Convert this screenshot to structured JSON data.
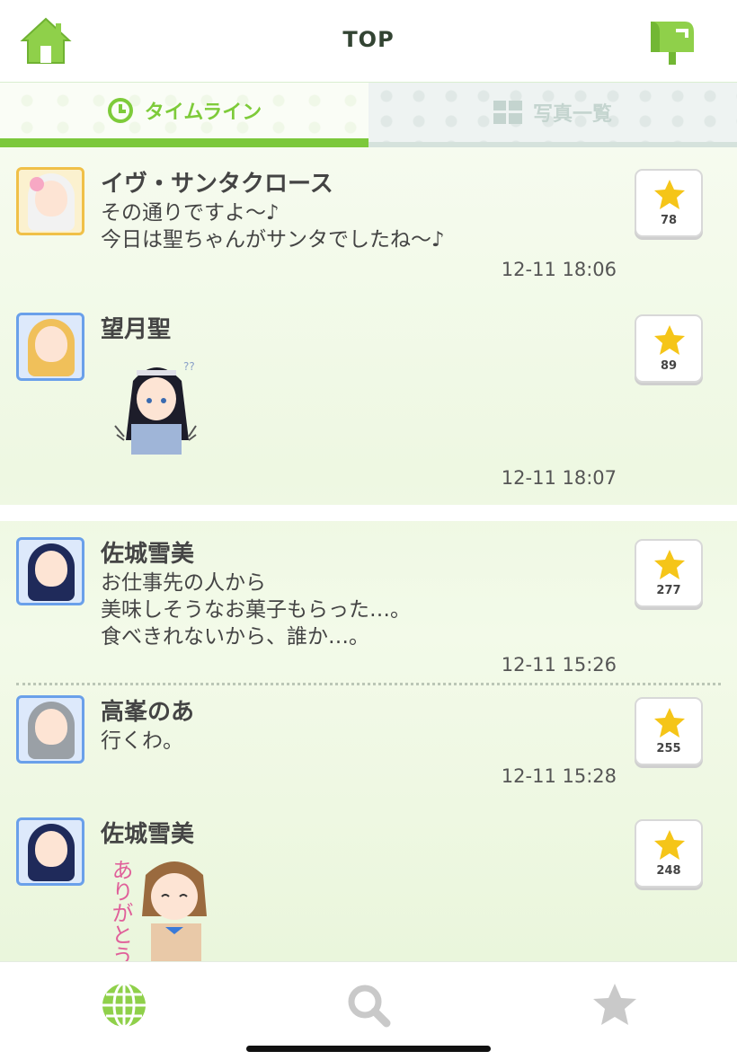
{
  "header": {
    "title": "TOP",
    "home_icon": "home-icon",
    "mail_icon": "mailbox-icon"
  },
  "tabs": [
    {
      "label": "タイムライン",
      "icon": "clock-icon",
      "active": true
    },
    {
      "label": "写真一覧",
      "icon": "grid-icon",
      "active": false
    }
  ],
  "posts": [
    {
      "name": "イヴ・サンタクロース",
      "message": "その通りですよ〜♪\n今日は聖ちゃんがサンタでしたね〜♪",
      "time": "12-11 18:06",
      "likes": "78",
      "has_sticker": false
    },
    {
      "name": "望月聖",
      "message": "",
      "time": "12-11 18:07",
      "likes": "89",
      "has_sticker": true
    },
    {
      "name": "佐城雪美",
      "message": "お仕事先の人から\n美味しそうなお菓子もらった…。\n食べきれないから、誰か…。",
      "time": "12-11 15:26",
      "likes": "277",
      "has_sticker": false
    },
    {
      "name": "高峯のあ",
      "message": "行くわ。",
      "time": "12-11 15:28",
      "likes": "255",
      "has_sticker": false
    },
    {
      "name": "佐城雪美",
      "message": "",
      "time": "",
      "likes": "248",
      "has_sticker": true
    }
  ],
  "sticker_text": "ありがとう",
  "bottom_nav": [
    {
      "icon": "globe-icon",
      "active": true
    },
    {
      "icon": "search-icon",
      "active": false
    },
    {
      "icon": "star-icon",
      "active": false
    }
  ],
  "colors": {
    "accent_green": "#7cc83c",
    "star_yellow": "#f5c518",
    "avatar_blue": "#6aa0ea"
  }
}
